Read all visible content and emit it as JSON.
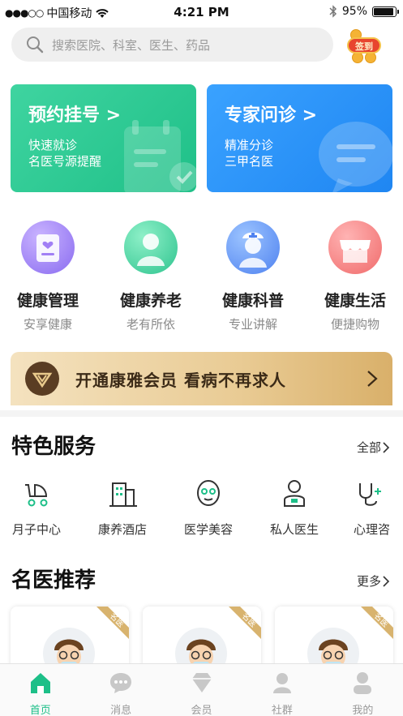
{
  "status_bar": {
    "carrier": "中国移动",
    "time": "4:21 PM",
    "battery": "95%",
    "battery_level": 0.95
  },
  "search": {
    "placeholder": "搜索医院、科室、医生、药品"
  },
  "signin": {
    "label": "签到"
  },
  "cards": [
    {
      "title": "预约挂号 >",
      "line1": "快速就诊",
      "line2": "名医号源提醒"
    },
    {
      "title": "专家问诊 >",
      "line1": "精准分诊",
      "line2": "三甲名医"
    }
  ],
  "categories": [
    {
      "name": "健康管理",
      "desc": "安享健康"
    },
    {
      "name": "健康养老",
      "desc": "老有所依"
    },
    {
      "name": "健康科普",
      "desc": "专业讲解"
    },
    {
      "name": "健康生活",
      "desc": "便捷购物"
    }
  ],
  "vip_banner": {
    "text": "开通康雅会员  看病不再求人"
  },
  "featured": {
    "title": "特色服务",
    "more": "全部",
    "items": [
      {
        "name": "月子中心"
      },
      {
        "name": "康养酒店"
      },
      {
        "name": "医学美容"
      },
      {
        "name": "私人医生"
      },
      {
        "name": "心理咨"
      }
    ]
  },
  "doctors": {
    "title": "名医推荐",
    "more": "更多",
    "ribbon": "名医"
  },
  "tabbar": [
    {
      "label": "首页",
      "active": true
    },
    {
      "label": "消息",
      "active": false
    },
    {
      "label": "会员",
      "active": false
    },
    {
      "label": "社群",
      "active": false
    },
    {
      "label": "我的",
      "active": false
    }
  ],
  "colors": {
    "accent_green": "#1dbf88",
    "card_green": "#26c48c",
    "card_blue": "#2b92f8",
    "vip_gold": "#e9cb94",
    "tab_inactive": "#999999"
  }
}
